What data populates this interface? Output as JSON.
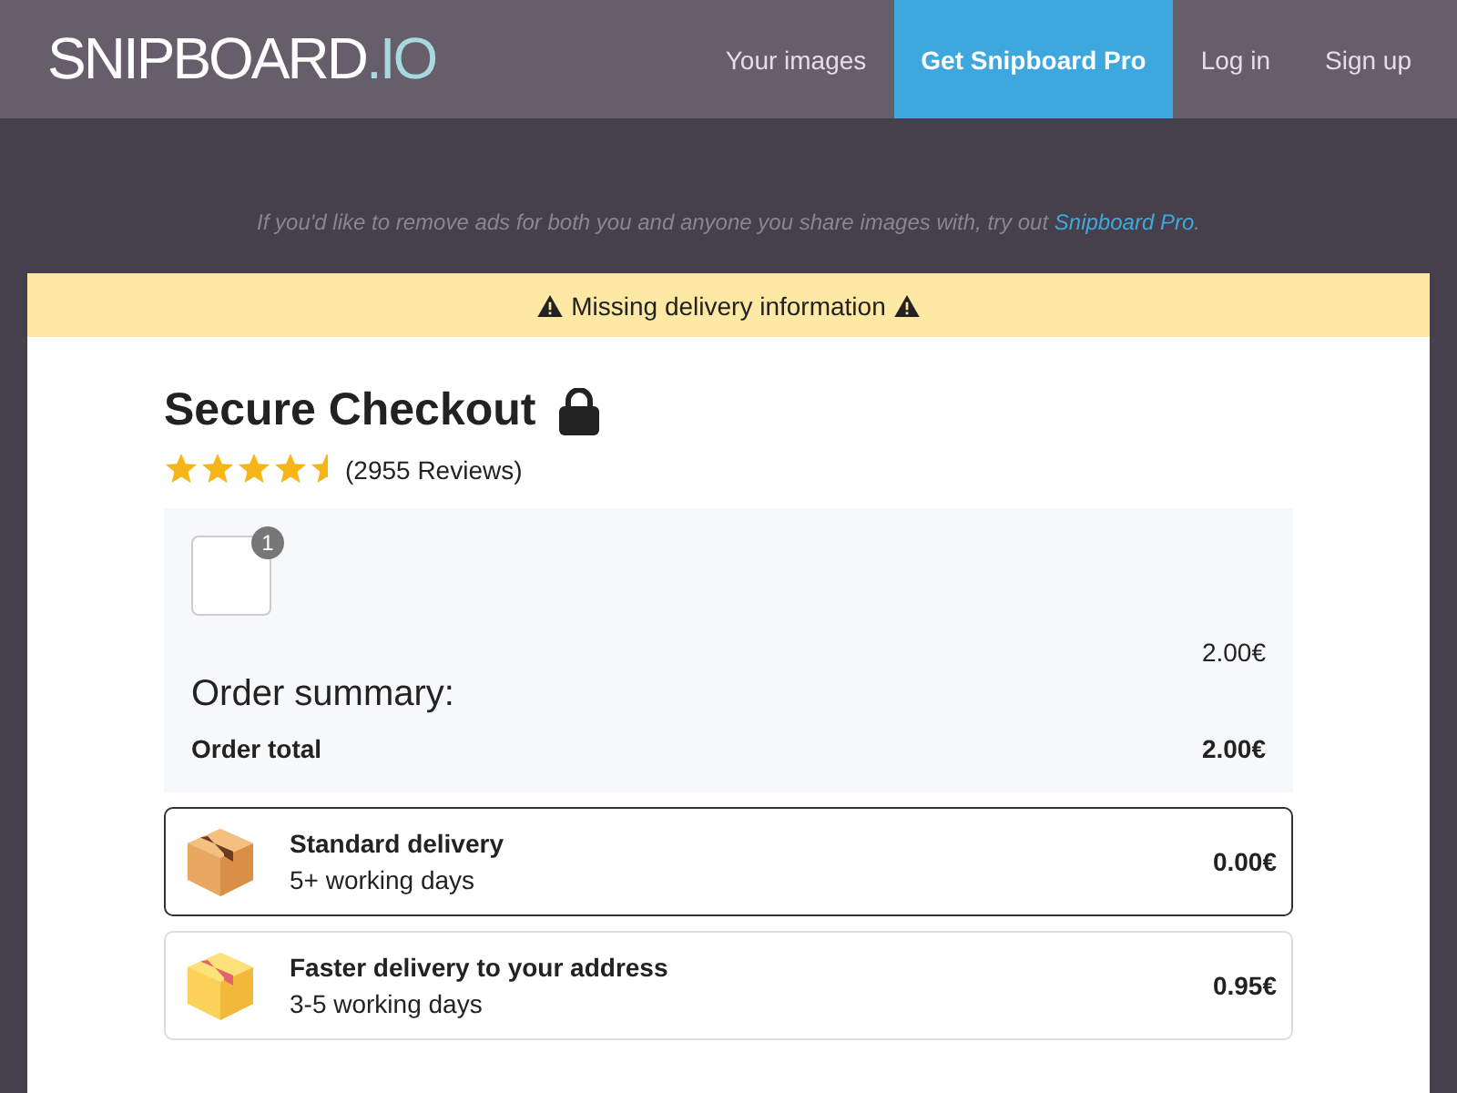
{
  "header": {
    "logo": {
      "name": "SNIPBOARD",
      "suffix": ".IO"
    },
    "nav": [
      {
        "label": "Your images",
        "selected": false
      },
      {
        "label": "Get Snipboard Pro",
        "selected": true
      },
      {
        "label": "Log in",
        "selected": false
      },
      {
        "label": "Sign up",
        "selected": false
      }
    ]
  },
  "notice": {
    "text": "If you'd like to remove ads for both you and anyone you share images with, try out",
    "link": "Snipboard Pro",
    "end": "."
  },
  "checkout": {
    "banner": "Missing delivery information",
    "title": "Secure Checkout",
    "stars": 4.5,
    "reviews": "(2955 Reviews)",
    "summary": {
      "item_count": "1",
      "item_price": "2.00€",
      "heading": "Order summary:",
      "total_label": "Order total",
      "total": "2.00€"
    },
    "delivery_options": [
      {
        "name": "Standard delivery",
        "time": "5+ working days",
        "price": "0.00€",
        "selected": true
      },
      {
        "name": "Faster delivery to your address",
        "time": "3-5 working days",
        "price": "0.95€",
        "selected": false
      }
    ]
  }
}
